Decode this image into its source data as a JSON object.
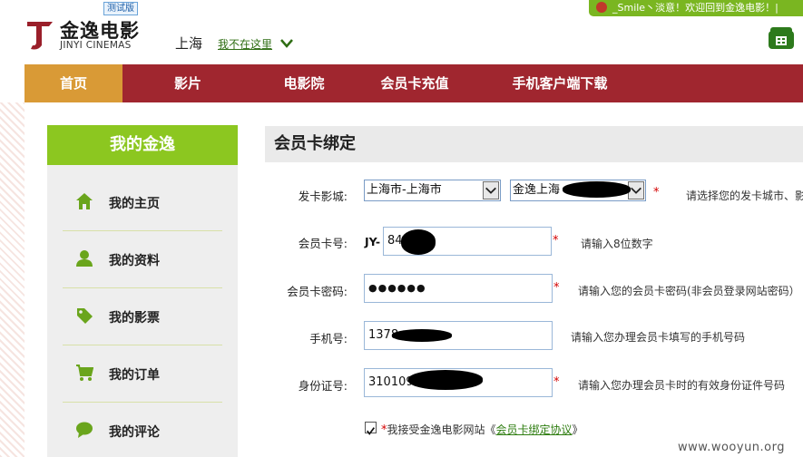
{
  "header": {
    "welcome_text": "_Smile丶淡意！欢迎回到金逸电影！|",
    "logo_cn": "金逸电影",
    "logo_en": "JINYI CINEMAS",
    "beta_badge": "测试版",
    "city": "上海",
    "not_here_link": "我不在这里"
  },
  "nav": {
    "items": [
      {
        "label": "首页"
      },
      {
        "label": "影片"
      },
      {
        "label": "电影院"
      },
      {
        "label": "会员卡充值"
      },
      {
        "label": "手机客户端下载"
      }
    ]
  },
  "sidebar": {
    "title": "我的金逸",
    "items": [
      {
        "label": "我的主页",
        "icon": "home-icon"
      },
      {
        "label": "我的资料",
        "icon": "user-icon"
      },
      {
        "label": "我的影票",
        "icon": "ticket-tag-icon"
      },
      {
        "label": "我的订单",
        "icon": "cart-icon"
      },
      {
        "label": "我的评论",
        "icon": "comment-icon"
      }
    ]
  },
  "form": {
    "title": "会员卡绑定",
    "cinema_label": "发卡影城:",
    "city_select_value": "上海市-上海市",
    "cinema_select_value": "金逸上海",
    "cinema_hint": "请选择您的发卡城市、影",
    "card_no_label": "会员卡号:",
    "card_no_prefix": "JY-",
    "card_no_value": "84      2",
    "card_no_hint": "请输入8位数字",
    "password_label": "会员卡密码:",
    "password_value": "●●●●●●",
    "password_hint": "请输入您的会员卡密码(非会员登录网站密码）",
    "phone_label": "手机号:",
    "phone_value": "1378",
    "phone_hint": "请输入您办理会员卡填写的手机号码",
    "id_label": "身份证号:",
    "id_value": "310109",
    "id_hint": "请输入您办理会员卡时的有效身份证件号码",
    "required_mark": "*",
    "agree_prefix": "我接受金逸电影网站《",
    "agree_link": "会员卡绑定协议",
    "agree_suffix": "》"
  },
  "watermark": "www.wooyun.org",
  "colors": {
    "nav_bg": "#a0262f",
    "nav_active": "#d99a36",
    "sidebar_head": "#8cc720",
    "accent_green": "#6aa51c"
  }
}
